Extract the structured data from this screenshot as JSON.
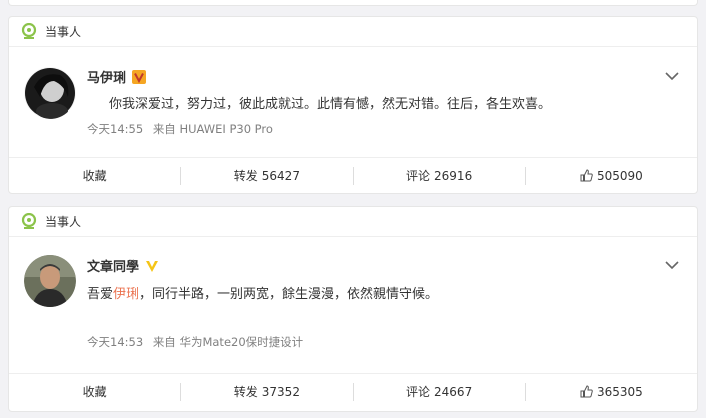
{
  "posts": [
    {
      "tag": "当事人",
      "name": "马伊琍",
      "badge_color": "#f5a623",
      "content_parts": [
        "你我深爱过，努力过，彼此成就过。此情有憾，然无对错。往后，各生欢喜。"
      ],
      "time": "今天14:55",
      "source": "来自 HUAWEI P30 Pro",
      "actions": {
        "favorite": "收藏",
        "repost_label": "转发",
        "repost_count": "56427",
        "comment_label": "评论",
        "comment_count": "26916",
        "like_count": "505090"
      }
    },
    {
      "tag": "当事人",
      "name": "文章同學",
      "badge_color": "#f5c518",
      "content_before": "吾爱",
      "content_mention": "伊琍",
      "content_after": "，同行半路，一别两宽，餘生漫漫，依然親情守候。",
      "time": "今天14:53",
      "source": "来自 华为Mate20保时捷设计",
      "actions": {
        "favorite": "收藏",
        "repost_label": "转发",
        "repost_count": "37352",
        "comment_label": "评论",
        "comment_count": "24667",
        "like_count": "365305"
      }
    }
  ],
  "colors": {
    "tag_icon": "#8bc34a",
    "mention": "#eb7350",
    "meta": "#808080"
  },
  "icons": {
    "tag": "location-pin-icon",
    "menu": "chevron-down-icon",
    "like": "thumbs-up-icon",
    "verified": "v-badge-icon"
  }
}
